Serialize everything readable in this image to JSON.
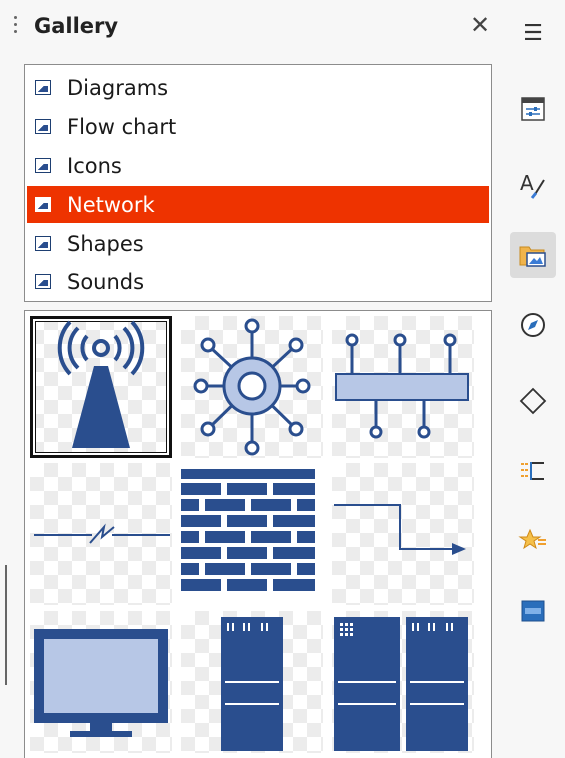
{
  "panel": {
    "title": "Gallery",
    "close_glyph": "✕"
  },
  "themes": {
    "items": [
      {
        "label": "Diagrams"
      },
      {
        "label": "Flow chart"
      },
      {
        "label": "Icons"
      },
      {
        "label": "Network"
      },
      {
        "label": "Shapes"
      },
      {
        "label": "Sounds"
      }
    ],
    "selected": "Network"
  },
  "gallery_items": [
    {
      "icon": "antenna-tower-icon"
    },
    {
      "icon": "network-hub-icon"
    },
    {
      "icon": "network-bus-icon"
    },
    {
      "icon": "lightning-link-icon"
    },
    {
      "icon": "firewall-icon"
    },
    {
      "icon": "connector-arrow-icon"
    },
    {
      "icon": "monitor-icon"
    },
    {
      "icon": "server-rack-icon"
    },
    {
      "icon": "server-cluster-icon"
    }
  ],
  "sidebar": {
    "menu_glyph": "☰",
    "buttons": [
      {
        "icon": "properties-icon"
      },
      {
        "icon": "styles-icon"
      },
      {
        "icon": "gallery-icon",
        "active": true
      },
      {
        "icon": "navigator-icon"
      },
      {
        "icon": "shapes-icon"
      },
      {
        "icon": "page-icon"
      },
      {
        "icon": "style-inspector-icon"
      },
      {
        "icon": "manage-changes-icon"
      }
    ]
  },
  "colors": {
    "selection": "#ee3300",
    "icon_blue": "#2a4e8e",
    "icon_light_blue": "#b7c7e6"
  }
}
